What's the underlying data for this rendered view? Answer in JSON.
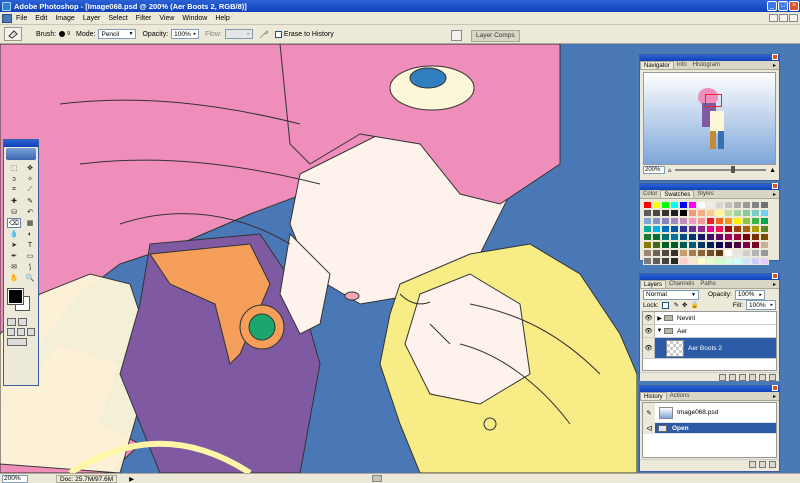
{
  "window": {
    "title": "Adobe Photoshop - [Image068.psd @ 200% (Aer Boots 2, RGB/8)]",
    "controls": [
      "_",
      "□",
      "×"
    ]
  },
  "menubar": {
    "items": [
      "File",
      "Edit",
      "Image",
      "Layer",
      "Select",
      "Filter",
      "View",
      "Window",
      "Help"
    ]
  },
  "options": {
    "brush_label": "Brush:",
    "brush_size": "9",
    "mode_label": "Mode:",
    "mode_value": "Pencil",
    "opacity_label": "Opacity:",
    "opacity_value": "100%",
    "flow_label": "Flow:",
    "flow_value": "",
    "erase_history_label": "Erase to History",
    "palette_well_tab": "Layer Comps"
  },
  "navigator": {
    "tabs": [
      "Navigator",
      "Info",
      "Histogram"
    ],
    "zoom": "200%",
    "slider_level": 0.62
  },
  "swatches": {
    "tabs": [
      "Color",
      "Swatches",
      "Styles"
    ],
    "colors": [
      "#ff0000",
      "#ffff00",
      "#00ff00",
      "#00ffff",
      "#0000ff",
      "#ff00ff",
      "#ffffff",
      "#ebebeb",
      "#d6d6d6",
      "#c2c2c2",
      "#adadad",
      "#999999",
      "#858585",
      "#707070",
      "#5c5c5c",
      "#474747",
      "#333333",
      "#1f1f1f",
      "#000000",
      "#f7977a",
      "#f9ad81",
      "#fdc68a",
      "#fff79a",
      "#c4df9b",
      "#a3d39c",
      "#82ca9d",
      "#7bcdc8",
      "#6ecff6",
      "#7ea7d8",
      "#8493ca",
      "#8882be",
      "#a187be",
      "#bc8dbf",
      "#f49ac2",
      "#f6989d",
      "#ed1c24",
      "#f26522",
      "#f7941d",
      "#fff200",
      "#8dc73f",
      "#39b54a",
      "#00a651",
      "#00a99d",
      "#00aeef",
      "#0072bc",
      "#0054a6",
      "#2e3192",
      "#662d91",
      "#92278f",
      "#ec008c",
      "#ed145b",
      "#9e0b0f",
      "#a0410d",
      "#a36209",
      "#aba000",
      "#598527",
      "#1a7b30",
      "#007236",
      "#00746b",
      "#0076a3",
      "#004b80",
      "#003471",
      "#1b1464",
      "#440e62",
      "#630460",
      "#9e005d",
      "#9e0039",
      "#790000",
      "#7b2e00",
      "#7d4900",
      "#827b00",
      "#406618",
      "#005e20",
      "#005826",
      "#005952",
      "#005b7f",
      "#003663",
      "#002157",
      "#0d004c",
      "#32004b",
      "#4b0049",
      "#7b0046",
      "#7a0026",
      "#c7b299",
      "#998675",
      "#736357",
      "#534741",
      "#37302d",
      "#c69c6d",
      "#a67c52",
      "#8c6239",
      "#754c24",
      "#603913",
      "#ffffff",
      "#e5e5e5",
      "#cfcfcf",
      "#b3b3b3",
      "#969696",
      "#7a7a7a",
      "#5e5e5e",
      "#424242",
      "#262626",
      "#ffcccc",
      "#ffe5cc",
      "#ffffcc",
      "#e5ffcc",
      "#ccffcc",
      "#ccffe5",
      "#ccffff",
      "#cce5ff",
      "#ccccff",
      "#e5ccff"
    ]
  },
  "layers": {
    "tabs": [
      "Layers",
      "Channels",
      "Paths"
    ],
    "blend_mode": "Normal",
    "opacity_label": "Opacity:",
    "opacity_value": "100%",
    "lock_label": "Lock:",
    "fill_label": "Fill:",
    "fill_value": "100%",
    "items": [
      {
        "name": "Neviril",
        "type": "group",
        "expanded": false
      },
      {
        "name": "Aer",
        "type": "group",
        "expanded": true
      },
      {
        "name": "Aer Boots 2",
        "type": "layer",
        "selected": true
      }
    ]
  },
  "history": {
    "tabs": [
      "History",
      "Actions"
    ],
    "items": [
      {
        "name": "Image068.psd",
        "type": "snapshot"
      },
      {
        "name": "Open",
        "type": "state",
        "selected": true
      }
    ]
  },
  "status": {
    "zoom": "200%",
    "doc": "Doc: 25.7M/97.6M",
    "arrow": "▶"
  },
  "toolbox": {
    "tools": [
      "marquee-tool",
      "move-tool",
      "lasso-tool",
      "magic-wand-tool",
      "crop-tool",
      "slice-tool",
      "healing-tool",
      "brush-tool",
      "stamp-tool",
      "history-brush-tool",
      "eraser-tool",
      "gradient-tool",
      "blur-tool",
      "dodge-tool",
      "path-select-tool",
      "type-tool",
      "pen-tool",
      "shape-tool",
      "notes-tool",
      "eyedropper-tool",
      "hand-tool",
      "zoom-tool"
    ],
    "glyphs": [
      "⬚",
      "✥",
      "ↄ",
      "✧",
      "⌗",
      "⟋",
      "✚",
      "✎",
      "⛁",
      "↶",
      "⌫",
      "▦",
      "💧",
      "◐",
      "➤",
      "T",
      "✒",
      "▭",
      "✉",
      "⟆",
      "✋",
      "🔍"
    ],
    "active_index": 10,
    "foreground": "#000000",
    "background": "#ffffff"
  }
}
